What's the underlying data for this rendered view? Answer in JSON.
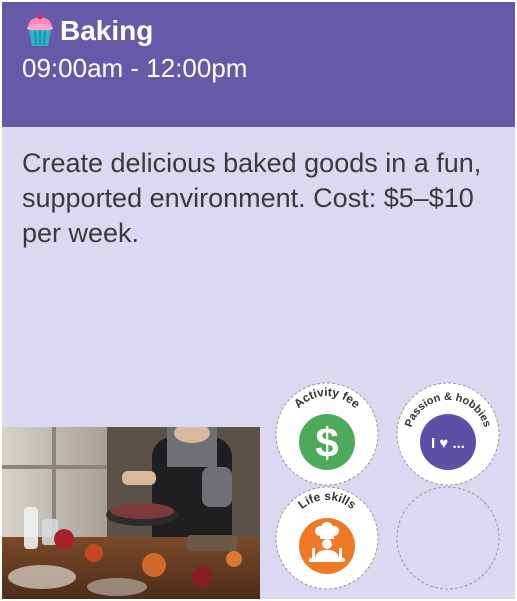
{
  "activity": {
    "title": "Baking",
    "time": "09:00am - 12:00pm",
    "description": "Create delicious baked goods in a fun, supported environment. Cost: $5–$10 per week.",
    "icon": "cupcake-icon",
    "header_color": "#6559a8",
    "body_color": "#dcd8f2"
  },
  "photo": {
    "subject": "baking-scene-photo"
  },
  "badges": [
    {
      "label": "Activity fee",
      "symbol": "$",
      "icon": "dollar-icon",
      "color": "#4daa5a"
    },
    {
      "label": "Passion & hobbies",
      "symbol": "I ♥ ...",
      "icon": "heart-icon",
      "color": "#5e4fa6"
    },
    {
      "label": "Life skills",
      "symbol": "",
      "icon": "chef-icon",
      "color": "#ef7a26"
    },
    {
      "label": "",
      "icon": "empty-badge-slot"
    }
  ]
}
